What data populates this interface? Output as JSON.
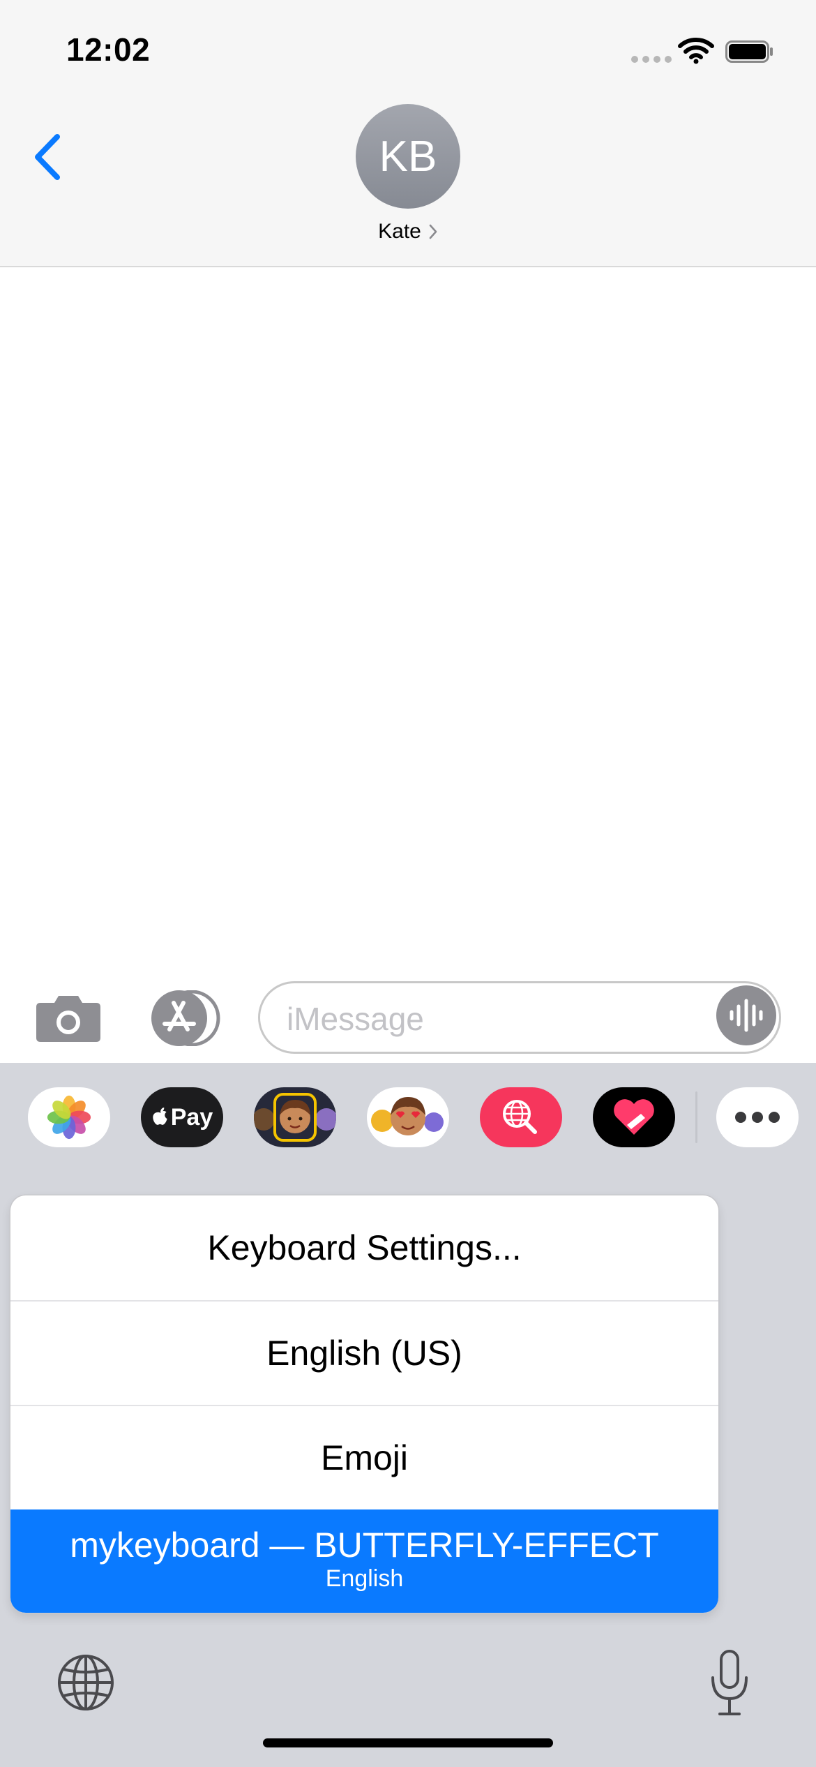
{
  "status_bar": {
    "time": "12:02"
  },
  "header": {
    "avatar_initials": "KB",
    "contact_name": "Kate"
  },
  "compose": {
    "placeholder": "iMessage"
  },
  "app_drawer": {
    "items": [
      "photos",
      "apple-pay",
      "memoji-stickers",
      "animoji",
      "image-search",
      "digital-touch",
      "more"
    ],
    "apple_pay_label": "Pay"
  },
  "keyboard_menu": {
    "items": [
      {
        "label": "Keyboard Settings..."
      },
      {
        "label": "English (US)"
      },
      {
        "label": "Emoji"
      },
      {
        "label": "mykeyboard — BUTTERFLY-EFFECT",
        "sublabel": "English",
        "selected": true
      }
    ]
  },
  "colors": {
    "accent": "#0a7aff",
    "keyboard_bg": "#d4d6dc",
    "header_bg": "#f6f6f6"
  }
}
